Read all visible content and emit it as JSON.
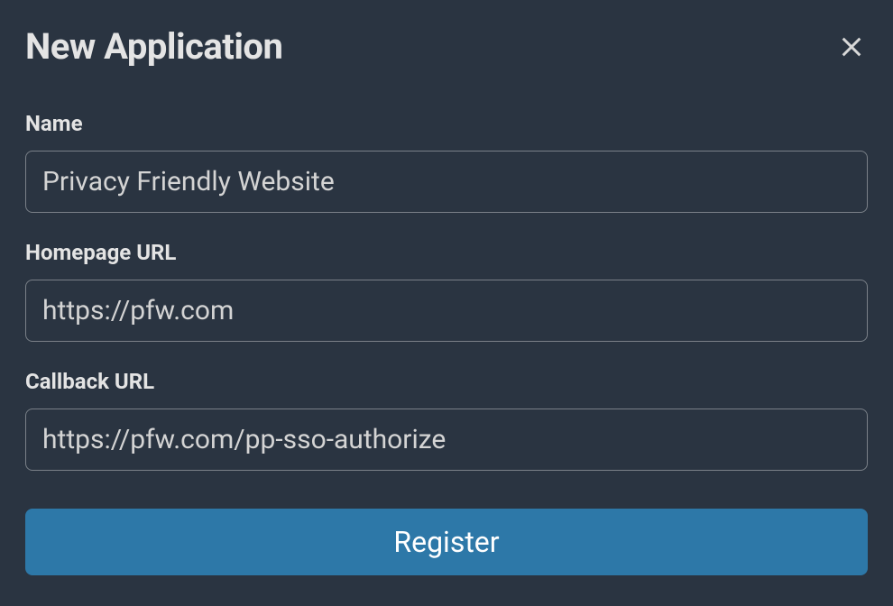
{
  "dialog": {
    "title": "New Application",
    "fields": {
      "name": {
        "label": "Name",
        "value": "Privacy Friendly Website"
      },
      "homepage": {
        "label": "Homepage URL",
        "value": "https://pfw.com"
      },
      "callback": {
        "label": "Callback URL",
        "value": "https://pfw.com/pp-sso-authorize"
      }
    },
    "submit_label": "Register"
  }
}
